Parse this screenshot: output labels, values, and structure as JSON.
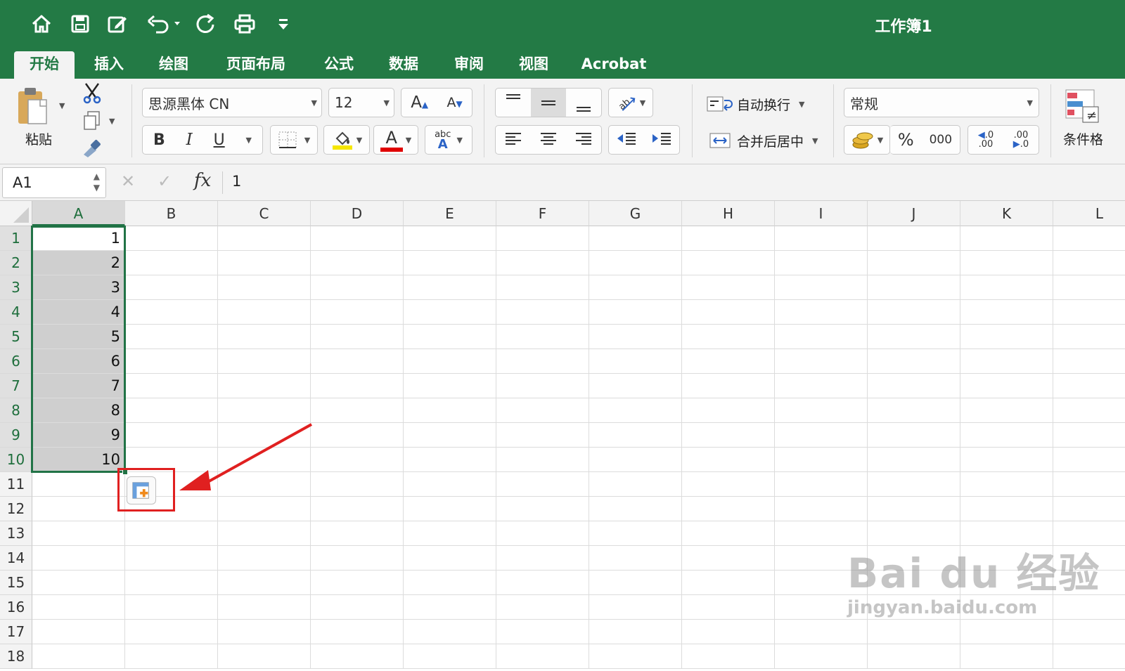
{
  "title_bar": {
    "document_title": "工作簿1",
    "quick_access": [
      "home-icon",
      "save-icon",
      "edit-icon",
      "undo-icon",
      "redo-icon",
      "print-icon",
      "customize-icon"
    ]
  },
  "tabs": [
    {
      "label": "开始",
      "active": true
    },
    {
      "label": "插入",
      "active": false
    },
    {
      "label": "绘图",
      "active": false
    },
    {
      "label": "页面布局",
      "active": false
    },
    {
      "label": "公式",
      "active": false
    },
    {
      "label": "数据",
      "active": false
    },
    {
      "label": "审阅",
      "active": false
    },
    {
      "label": "视图",
      "active": false
    },
    {
      "label": "Acrobat",
      "active": false
    }
  ],
  "ribbon": {
    "paste_label": "粘贴",
    "font_name": "思源黑体 CN",
    "font_size": "12",
    "bold": "B",
    "italic": "I",
    "underline": "U",
    "font_color_glyph": "A",
    "phonetic_glyph": "abc",
    "wrap_text_label": "自动换行",
    "merge_center_label": "合并后居中",
    "number_format": "常规",
    "percent_glyph": "%",
    "comma_glyph": "000",
    "increase_decimal_glyph": ".0",
    "decrease_decimal_glyph": ".00",
    "conditional_format_label": "条件格",
    "fill_color": "#f5e600",
    "font_color": "#e00000"
  },
  "formula_bar": {
    "name_box": "A1",
    "cancel_glyph": "✕",
    "enter_glyph": "✓",
    "fx_glyph": "fx",
    "content": "1"
  },
  "grid": {
    "columns": [
      "A",
      "B",
      "C",
      "D",
      "E",
      "F",
      "G",
      "H",
      "I",
      "J",
      "K",
      "L"
    ],
    "rows": [
      "1",
      "2",
      "3",
      "4",
      "5",
      "6",
      "7",
      "8",
      "9",
      "10",
      "11",
      "12",
      "13",
      "14",
      "15",
      "16",
      "17",
      "18"
    ],
    "column_a_values": [
      "1",
      "2",
      "3",
      "4",
      "5",
      "6",
      "7",
      "8",
      "9",
      "10"
    ],
    "selected_column": "A",
    "selected_rows": [
      "1",
      "2",
      "3",
      "4",
      "5",
      "6",
      "7",
      "8",
      "9",
      "10"
    ]
  },
  "watermark": {
    "brand": "Bai du 经验",
    "url": "jingyan.baidu.com"
  },
  "colors": {
    "excel_green": "#237a45",
    "selection_border": "#217346",
    "highlight_red": "#e02020"
  }
}
